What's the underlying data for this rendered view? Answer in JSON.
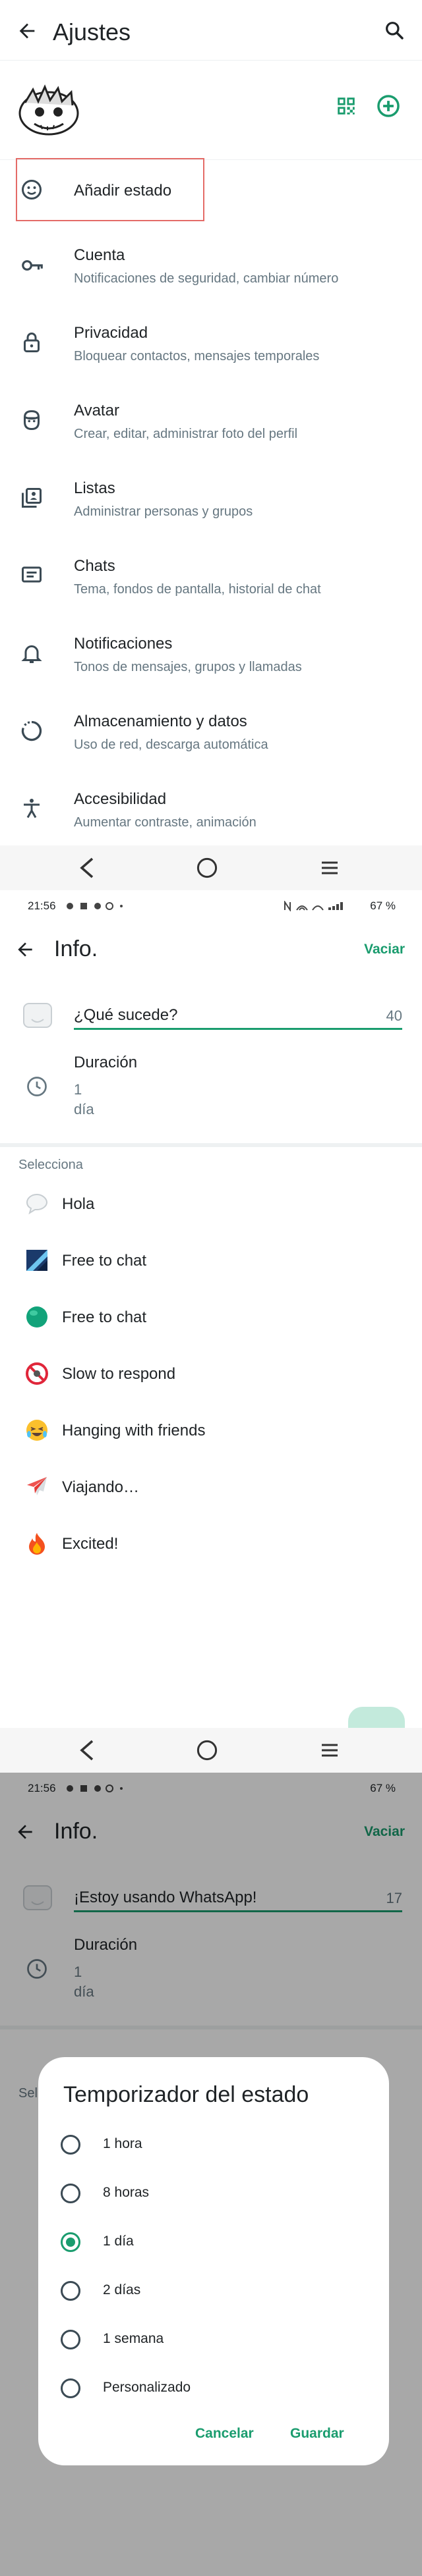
{
  "settings_screen": {
    "title": "Ajustes",
    "items": [
      {
        "title": "Añadir estado",
        "subtitle": "",
        "icon": "smiley-icon"
      },
      {
        "title": "Cuenta",
        "subtitle": "Notificaciones de seguridad, cambiar número",
        "icon": "key-icon"
      },
      {
        "title": "Privacidad",
        "subtitle": "Bloquear contactos, mensajes temporales",
        "icon": "lock-icon"
      },
      {
        "title": "Avatar",
        "subtitle": "Crear, editar, administrar foto del perfil",
        "icon": "avatar-icon"
      },
      {
        "title": "Listas",
        "subtitle": "Administrar personas y grupos",
        "icon": "lists-icon"
      },
      {
        "title": "Chats",
        "subtitle": "Tema, fondos de pantalla, historial de chat",
        "icon": "chat-icon"
      },
      {
        "title": "Notificaciones",
        "subtitle": "Tonos de mensajes, grupos y llamadas",
        "icon": "bell-icon"
      },
      {
        "title": "Almacenamiento y datos",
        "subtitle": "Uso de red, descarga automática",
        "icon": "storage-icon"
      },
      {
        "title": "Accesibilidad",
        "subtitle": "Aumentar contraste, animación",
        "icon": "accessibility-icon"
      }
    ]
  },
  "info_screen": {
    "status_time": "21:56",
    "battery": "67 %",
    "title": "Info.",
    "clear_label": "Vaciar",
    "status_placeholder": "¿Qué sucede?",
    "char_count": "40",
    "duration_label": "Duración",
    "duration_value": "1",
    "duration_unit": "día",
    "section_label": "Selecciona",
    "options": [
      {
        "label": "Hola",
        "icon": "speech-bubble-icon"
      },
      {
        "label": "Free to chat",
        "icon": "blue-square-icon"
      },
      {
        "label": "Free to chat",
        "icon": "green-circle-icon"
      },
      {
        "label": "Slow to respond",
        "icon": "no-entry-icon"
      },
      {
        "label": "Hanging with friends",
        "icon": "laughing-face-icon"
      },
      {
        "label": "Viajando…",
        "icon": "airplane-icon"
      },
      {
        "label": "Excited!",
        "icon": "fire-icon"
      }
    ]
  },
  "dialog_screen": {
    "status_time": "21:56",
    "battery": "67 %",
    "title": "Info.",
    "clear_label": "Vaciar",
    "status_text": "¡Estoy usando WhatsApp!",
    "char_count": "17",
    "duration_label": "Duración",
    "duration_value": "1",
    "duration_unit": "día",
    "section_label_partial": "Sel",
    "dialog": {
      "title": "Temporizador del estado",
      "options": [
        {
          "label": "1 hora",
          "selected": false
        },
        {
          "label": "8 horas",
          "selected": false
        },
        {
          "label": "1 día",
          "selected": true
        },
        {
          "label": "2 días",
          "selected": false
        },
        {
          "label": "1 semana",
          "selected": false
        },
        {
          "label": "Personalizado",
          "selected": false
        }
      ],
      "cancel_label": "Cancelar",
      "save_label": "Guardar"
    }
  },
  "colors": {
    "accent": "#1a9c6e",
    "highlight": "#e46b67"
  }
}
